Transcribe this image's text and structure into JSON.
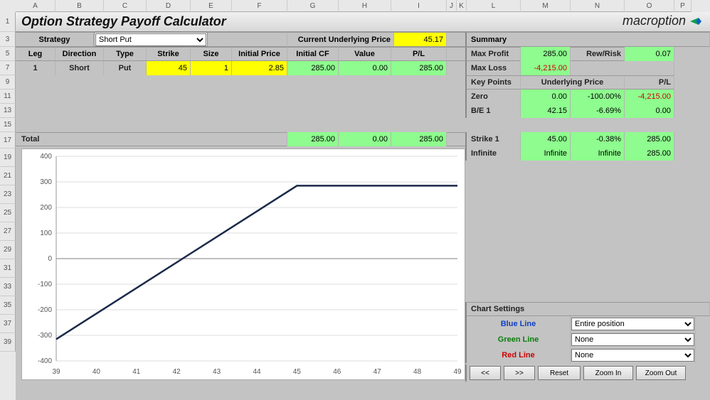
{
  "title": "Option Strategy Payoff Calculator",
  "brand": "macroption",
  "columns": [
    "A",
    "B",
    "C",
    "D",
    "E",
    "F",
    "G",
    "H",
    "I",
    "J",
    "K",
    "L",
    "M",
    "N",
    "O",
    "P"
  ],
  "row_numbers": [
    1,
    3,
    5,
    7,
    9,
    11,
    13,
    15,
    17,
    19,
    21,
    23,
    25,
    27,
    29,
    31,
    33,
    35,
    37,
    39
  ],
  "strategy_label": "Strategy",
  "strategy_value": "Short Put",
  "cup_label": "Current Underlying Price",
  "cup_value": "45.17",
  "leg_headers": [
    "Leg",
    "Direction",
    "Type",
    "Strike",
    "Size",
    "Initial Price",
    "Initial CF",
    "Value",
    "P/L"
  ],
  "leg": {
    "num": "1",
    "direction": "Short",
    "type": "Put",
    "strike": "45",
    "size": "1",
    "initprice": "2.85",
    "initcf": "285.00",
    "value": "0.00",
    "pl": "285.00"
  },
  "totals_label": "Total",
  "totals": {
    "initcf": "285.00",
    "value": "0.00",
    "pl": "285.00"
  },
  "summary_label": "Summary",
  "summary": {
    "maxprofit_label": "Max Profit",
    "maxprofit": "285.00",
    "rewr_label": "Rew/Risk",
    "rewr": "0.07",
    "maxloss_label": "Max Loss",
    "maxloss": "-4,215.00"
  },
  "keypoints_label": "Key Points",
  "kp_headers": [
    "Underlying Price",
    "P/L"
  ],
  "kp_rows": [
    {
      "name": "Zero",
      "v1": "0.00",
      "v2": "-100.00%",
      "v3": "-4,215.00",
      "v3_neg": true
    },
    {
      "name": "B/E 1",
      "v1": "42.15",
      "v2": "-6.69%",
      "v3": "0.00"
    },
    {
      "name": "Strike 1",
      "v1": "45.00",
      "v2": "-0.38%",
      "v3": "285.00"
    },
    {
      "name": "Infinite",
      "v1": "Infinite",
      "v2": "Infinite",
      "v3": "285.00"
    }
  ],
  "chart_settings_label": "Chart Settings",
  "lines": {
    "blue_label": "Blue Line",
    "blue_value": "Entire position",
    "green_label": "Green Line",
    "green_value": "None",
    "red_label": "Red Line",
    "red_value": "None"
  },
  "buttons": {
    "prev": "<<",
    "next": ">>",
    "reset": "Reset",
    "zin": "Zoom In",
    "zout": "Zoom Out"
  },
  "chart_data": {
    "type": "line",
    "title": "",
    "xlabel": "",
    "ylabel": "",
    "xlim": [
      39,
      49
    ],
    "ylim": [
      -400,
      400
    ],
    "xticks": [
      39,
      40,
      41,
      42,
      43,
      44,
      45,
      46,
      47,
      48,
      49
    ],
    "yticks": [
      -400,
      -300,
      -200,
      -100,
      0,
      100,
      200,
      300,
      400
    ],
    "series": [
      {
        "name": "Entire position",
        "color": "#1b2a4a",
        "x": [
          39,
          40,
          41,
          42,
          43,
          44,
          45,
          46,
          47,
          48,
          49
        ],
        "y": [
          -315,
          -215,
          -115,
          -15,
          85,
          185,
          285,
          285,
          285,
          285,
          285
        ]
      }
    ]
  }
}
